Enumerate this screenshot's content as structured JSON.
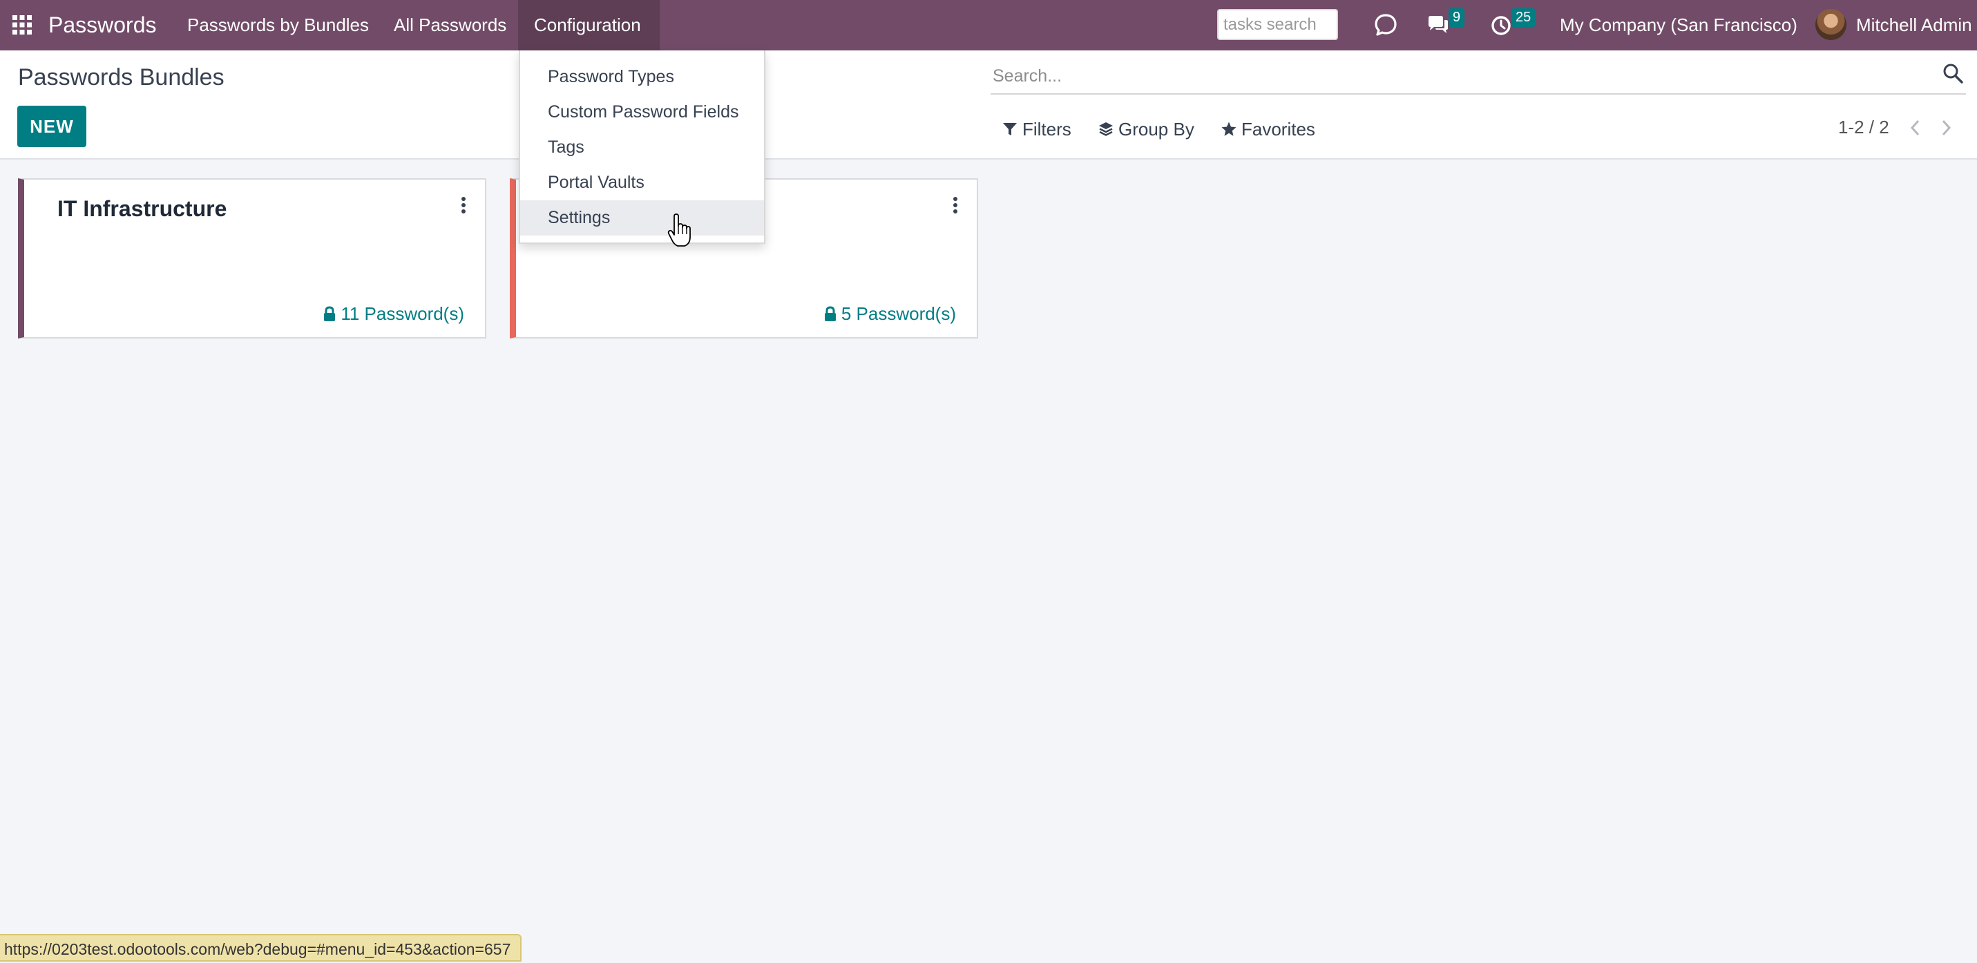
{
  "navbar": {
    "brand": "Passwords",
    "menu": {
      "bundles": "Passwords by Bundles",
      "all": "All Passwords",
      "configuration": "Configuration"
    },
    "tasks_search_placeholder": "tasks search",
    "chat_count": "9",
    "activity_count": "25",
    "company": "My Company (San Francisco)",
    "user": "Mitchell Admin"
  },
  "control_panel": {
    "title": "Passwords Bundles",
    "new_label": "NEW",
    "search_placeholder": "Search...",
    "filters_label": "Filters",
    "groupby_label": "Group By",
    "favorites_label": "Favorites",
    "pager": "1-2 / 2"
  },
  "cards": [
    {
      "title": "IT Infrastructure",
      "count_label": "11 Password(s)",
      "color": "#714b67"
    },
    {
      "title": "",
      "count_label": "5 Password(s)",
      "color": "#e8685c"
    }
  ],
  "config_menu": {
    "items": [
      "Password Types",
      "Custom Password Fields",
      "Tags",
      "Portal Vaults",
      "Settings"
    ],
    "hovered": "Settings"
  },
  "status_bar": {
    "url": "https://0203test.odootools.com/web?debug=#menu_id=453&action=657"
  },
  "colors": {
    "navbar": "#714b67",
    "accent": "#017e84",
    "background": "#f4f5f9"
  }
}
